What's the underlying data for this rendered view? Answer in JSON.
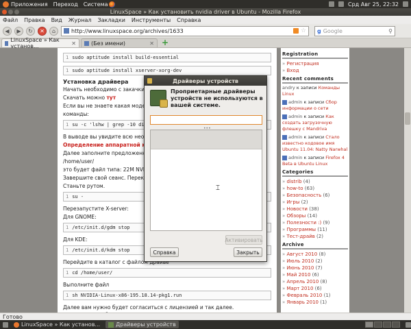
{
  "top_panel": {
    "menus": [
      "Приложения",
      "Переход",
      "Система"
    ],
    "clock": "Срд Авг 25, 22:32"
  },
  "window": {
    "title": "LinuxSpace » Как установить nvidia driver в Ubuntu - Mozilla Firefox"
  },
  "menubar": [
    "Файл",
    "Правка",
    "Вид",
    "Журнал",
    "Закладки",
    "Инструменты",
    "Справка"
  ],
  "navbar": {
    "url": "http://www.linuxspace.org/archives/1633",
    "search_placeholder": "Google"
  },
  "tabs": [
    {
      "label": "LinuxSpace » Как установ..."
    },
    {
      "label": "(Без имени)"
    }
  ],
  "article": {
    "code1": "sudo aptitude install build-essential",
    "code2": "sudo aptitude install xserver-xorg-dev",
    "heading_install": "Установка драйвера",
    "p1": "Начать необходимо с закачки с официа",
    "p2_prefix": "Скачать можно ",
    "p2_link": "тут",
    "p3": "Если вы не знаете какая модель ваше",
    "p4": "команды:",
    "code3": "su -c 'lshw | grep -10 display'",
    "p5": "В выводе вы увидите всю необходиму",
    "p6_link": "Определение аппаратной конфигура",
    "p7": "Далее заполните предложенную форм",
    "p8": "/home/user/",
    "p9": "это будет файл типа: 22M NVIDIA-Linu",
    "p10": "Завершите свой сеанс. Переключитес",
    "p11": "Станьте рутом.",
    "code4": "su -",
    "p12": "Перезапустите X-server:",
    "p13": "Для GNOME:",
    "code5": "/etc/init.d/gdm stop",
    "p14": "Для KDE:",
    "code6": "/etc/init.d/kdm stop",
    "p15": "Перейдите в каталог с файлом драйве",
    "code7": "cd /home/user/",
    "p16": "Выполните файл",
    "code8": "sh NVIDIA-Linux-x86-195.18.14-pkg1.run",
    "p17": "Далее вам нужно будет согласиться с лицензией и так далее. Единственное, будьте внимательны и читайте, что пишет вам программа, прежде чем нажать да или нет. В принципе на все запросы, вы можете ответить да, кроме того, где система предложит скачать и запустить утилиту nvidia-xconfig. Откажитесь!)"
  },
  "sidebar": {
    "registration_head": "Registration",
    "registration_links": [
      "Регистрация",
      "Вход"
    ],
    "recent_head": "Recent comments",
    "comments": [
      {
        "who": "andry",
        "pre": " к записи ",
        "link": "Команды Linux"
      },
      {
        "who": "admin",
        "pre": " к записи ",
        "link": "Сбор информации о сети"
      },
      {
        "who": "admin",
        "pre": " к записи ",
        "link": "Как создать загрузочную флешку с Mandriva"
      },
      {
        "who": "admin",
        "pre": " к записи ",
        "link": "Стало известно кодовое имя Ubuntu 11.04: Natty Narwhal"
      },
      {
        "who": "admin",
        "pre": " к записи ",
        "link": "Firefox 4 Beta в Ubuntu Linux"
      }
    ],
    "categories_head": "Categories",
    "categories": [
      {
        "name": "distrib",
        "count": "(4)"
      },
      {
        "name": "how-to",
        "count": "(63)"
      },
      {
        "name": "Безопасность",
        "count": "(6)"
      },
      {
        "name": "Игры",
        "count": "(2)"
      },
      {
        "name": "Новости",
        "count": "(38)"
      },
      {
        "name": "Обзоры",
        "count": "(14)"
      },
      {
        "name": "Полезности :)",
        "count": "(9)"
      },
      {
        "name": "Программы",
        "count": "(11)"
      },
      {
        "name": "Тест-драйв",
        "count": "(2)"
      }
    ],
    "archive_head": "Archive",
    "archive": [
      {
        "name": "Август 2010",
        "count": "(8)"
      },
      {
        "name": "Июль 2010",
        "count": "(2)"
      },
      {
        "name": "Июнь 2010",
        "count": "(7)"
      },
      {
        "name": "Май 2010",
        "count": "(6)"
      },
      {
        "name": "Апрель 2010",
        "count": "(8)"
      },
      {
        "name": "Март 2010",
        "count": "(6)"
      },
      {
        "name": "Февраль 2010",
        "count": "(1)"
      },
      {
        "name": "Январь 2010",
        "count": "(1)"
      }
    ]
  },
  "status": "Готово",
  "taskbar": [
    {
      "label": "LinuxSpace » Как установ..."
    },
    {
      "label": "Драйверы устройств"
    }
  ],
  "dialog": {
    "title": "Драйверы устройств",
    "heading": "Проприетарные драйверы устройств не используются в вашей системе.",
    "activate": "Активировать",
    "help": "Справка",
    "close": "Закрыть"
  }
}
